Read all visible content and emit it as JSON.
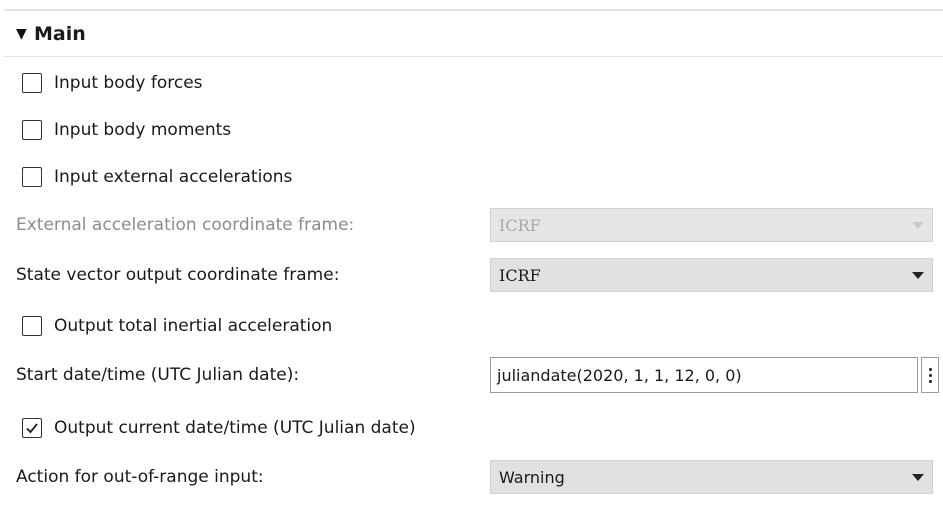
{
  "section": {
    "title": "Main"
  },
  "checkboxes": {
    "body_forces": {
      "label": "Input body forces",
      "checked": false
    },
    "body_moments": {
      "label": "Input body moments",
      "checked": false
    },
    "external_accel": {
      "label": "Input external accelerations",
      "checked": false
    },
    "total_inertial": {
      "label": "Output total inertial acceleration",
      "checked": false
    },
    "current_datetime": {
      "label": "Output current date/time (UTC Julian date)",
      "checked": true
    }
  },
  "fields": {
    "ext_accel_frame": {
      "label": "External acceleration coordinate frame:",
      "value": "ICRF",
      "disabled": true
    },
    "state_vector_frame": {
      "label": "State vector output coordinate frame:",
      "value": "ICRF",
      "disabled": false
    },
    "start_datetime": {
      "label": "Start date/time (UTC Julian date):",
      "value": "juliandate(2020, 1, 1, 12, 0, 0)"
    },
    "out_of_range_action": {
      "label": "Action for out-of-range input:",
      "value": "Warning",
      "disabled": false
    }
  },
  "icons": {
    "collapse": "triangle-down-icon",
    "dropdown": "caret-down-icon",
    "checkmark": "checkmark-icon",
    "more": "vertical-ellipsis-icon"
  }
}
